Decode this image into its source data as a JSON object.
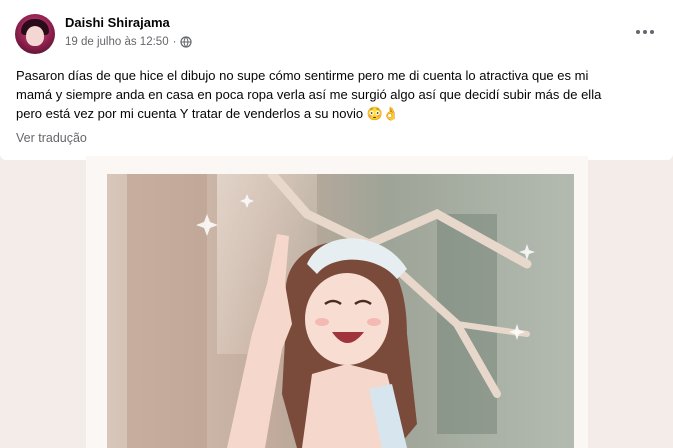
{
  "post": {
    "author": "Daishi Shirajama",
    "timestamp": "19 de julho às 12:50",
    "separator": "·",
    "privacy_icon": "globe-icon",
    "more_icon": "more-options-icon",
    "text_line1": "Pasaron días de que hice el dibujo no supe cómo sentirme pero me di cuenta lo atractiva que es mi",
    "text_line2": "mamá y siempre anda en casa en poca ropa verla así me surgió algo así que decidí subir más de ella",
    "text_line3": "pero está vez por mi cuenta Y tratar de venderlos a su novio",
    "emojis": [
      "😳",
      "👌"
    ],
    "translate_link": "Ver tradução"
  },
  "colors": {
    "background": "#f3ece8",
    "card": "#ffffff",
    "secondary_text": "#65676b"
  }
}
